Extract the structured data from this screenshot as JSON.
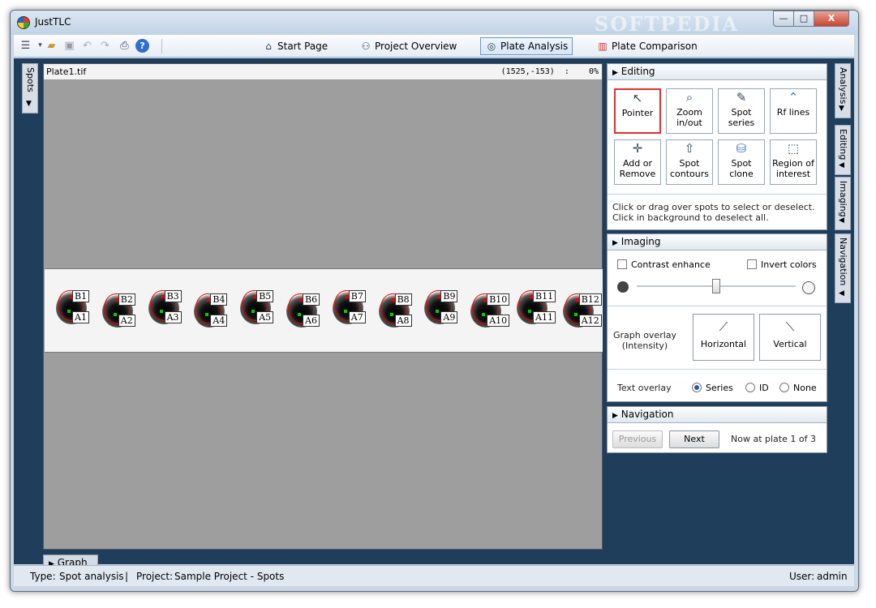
{
  "window": {
    "title": "JustTLC",
    "watermark": "SOFTPEDIA",
    "min_label": "—",
    "max_label": "□",
    "close_label": "X"
  },
  "toolbar": {
    "icons": [
      "list-icon",
      "open-folder-icon",
      "save-icon",
      "undo-icon",
      "redo-icon",
      "print-icon",
      "help-icon"
    ],
    "nav": [
      {
        "label": "Start Page",
        "icon": "start-page-icon"
      },
      {
        "label": "Project Overview",
        "icon": "project-overview-icon"
      },
      {
        "label": "Plate Analysis",
        "icon": "plate-analysis-icon",
        "active": true
      },
      {
        "label": "Plate Comparison",
        "icon": "plate-comparison-icon"
      }
    ]
  },
  "left_panel": {
    "spots_tab": "Spots"
  },
  "image": {
    "name": "Plate1.tif",
    "coords": "(1525,-153)  :    0%",
    "spots": [
      {
        "top": "B1",
        "bottom": "A1"
      },
      {
        "top": "B2",
        "bottom": "A2"
      },
      {
        "top": "B3",
        "bottom": "A3"
      },
      {
        "top": "B4",
        "bottom": "A4"
      },
      {
        "top": "B5",
        "bottom": "A5"
      },
      {
        "top": "B6",
        "bottom": "A6"
      },
      {
        "top": "B7",
        "bottom": "A7"
      },
      {
        "top": "B8",
        "bottom": "A8"
      },
      {
        "top": "B9",
        "bottom": "A9"
      },
      {
        "top": "B10",
        "bottom": "A10"
      },
      {
        "top": "B11",
        "bottom": "A11"
      },
      {
        "top": "B12",
        "bottom": "A12"
      }
    ]
  },
  "graph_tab": "Graph",
  "editing": {
    "header": "Editing",
    "tools": [
      {
        "label": "Pointer",
        "icon": "pointer-icon",
        "selected": true
      },
      {
        "label": "Zoom in/out",
        "icon": "zoom-icon"
      },
      {
        "label": "Spot series",
        "icon": "spot-series-icon"
      },
      {
        "label": "Rf lines",
        "icon": "rf-lines-icon"
      },
      {
        "label": "Add or Remove",
        "icon": "add-remove-icon"
      },
      {
        "label": "Spot contours",
        "icon": "spot-contours-icon"
      },
      {
        "label": "Spot clone",
        "icon": "spot-clone-icon"
      },
      {
        "label": "Region of interest",
        "icon": "region-of-interest-icon"
      }
    ],
    "hint": "Click or drag over spots to select or deselect. Click in background to deselect all."
  },
  "imaging": {
    "header": "Imaging",
    "contrast_enhance": "Contrast enhance",
    "invert_colors": "Invert colors",
    "slider_value": 0.5,
    "graph_overlay_label": "Graph overlay (Intensity)",
    "horizontal": "Horizontal",
    "vertical": "Vertical",
    "text_overlay_label": "Text overlay",
    "text_overlay_options": [
      "Series",
      "ID",
      "None"
    ],
    "text_overlay_selected": "Series"
  },
  "navigation": {
    "header": "Navigation",
    "previous": "Previous",
    "next": "Next",
    "status": "Now at plate 1 of 3"
  },
  "right_tabs": [
    "Analysis",
    "Editing",
    "Imaging",
    "Navigation"
  ],
  "status": {
    "type_label": "Type:",
    "type_value": "Spot analysis",
    "separator": "|",
    "project_label": "Project:",
    "project_value": "Sample Project - Spots",
    "user_label": "User:",
    "user_value": "admin"
  },
  "colors": {
    "workspace_bg": "#1f3e5c",
    "selected_border": "#e03030",
    "contour": "#e00000",
    "marker_red": "#e00000",
    "marker_green": "#00c000"
  }
}
